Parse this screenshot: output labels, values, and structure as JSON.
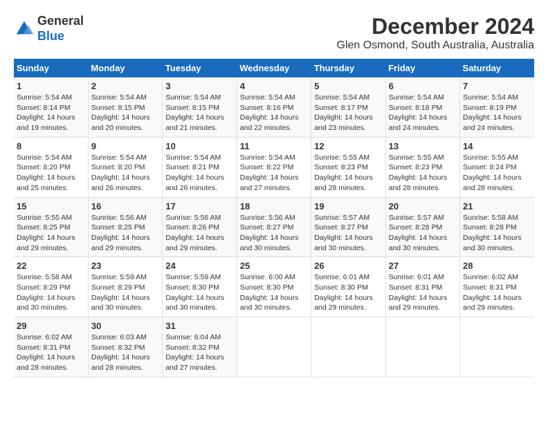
{
  "logo": {
    "line1": "General",
    "line2": "Blue"
  },
  "title": "December 2024",
  "subtitle": "Glen Osmond, South Australia, Australia",
  "days_of_week": [
    "Sunday",
    "Monday",
    "Tuesday",
    "Wednesday",
    "Thursday",
    "Friday",
    "Saturday"
  ],
  "weeks": [
    [
      {
        "day": "1",
        "sunrise": "5:54 AM",
        "sunset": "8:14 PM",
        "daylight": "14 hours and 19 minutes."
      },
      {
        "day": "2",
        "sunrise": "5:54 AM",
        "sunset": "8:15 PM",
        "daylight": "14 hours and 20 minutes."
      },
      {
        "day": "3",
        "sunrise": "5:54 AM",
        "sunset": "8:15 PM",
        "daylight": "14 hours and 21 minutes."
      },
      {
        "day": "4",
        "sunrise": "5:54 AM",
        "sunset": "8:16 PM",
        "daylight": "14 hours and 22 minutes."
      },
      {
        "day": "5",
        "sunrise": "5:54 AM",
        "sunset": "8:17 PM",
        "daylight": "14 hours and 23 minutes."
      },
      {
        "day": "6",
        "sunrise": "5:54 AM",
        "sunset": "8:18 PM",
        "daylight": "14 hours and 24 minutes."
      },
      {
        "day": "7",
        "sunrise": "5:54 AM",
        "sunset": "8:19 PM",
        "daylight": "14 hours and 24 minutes."
      }
    ],
    [
      {
        "day": "8",
        "sunrise": "5:54 AM",
        "sunset": "8:20 PM",
        "daylight": "14 hours and 25 minutes."
      },
      {
        "day": "9",
        "sunrise": "5:54 AM",
        "sunset": "8:20 PM",
        "daylight": "14 hours and 26 minutes."
      },
      {
        "day": "10",
        "sunrise": "5:54 AM",
        "sunset": "8:21 PM",
        "daylight": "14 hours and 26 minutes."
      },
      {
        "day": "11",
        "sunrise": "5:54 AM",
        "sunset": "8:22 PM",
        "daylight": "14 hours and 27 minutes."
      },
      {
        "day": "12",
        "sunrise": "5:55 AM",
        "sunset": "8:23 PM",
        "daylight": "14 hours and 28 minutes."
      },
      {
        "day": "13",
        "sunrise": "5:55 AM",
        "sunset": "8:23 PM",
        "daylight": "14 hours and 28 minutes."
      },
      {
        "day": "14",
        "sunrise": "5:55 AM",
        "sunset": "8:24 PM",
        "daylight": "14 hours and 28 minutes."
      }
    ],
    [
      {
        "day": "15",
        "sunrise": "5:55 AM",
        "sunset": "8:25 PM",
        "daylight": "14 hours and 29 minutes."
      },
      {
        "day": "16",
        "sunrise": "5:56 AM",
        "sunset": "8:25 PM",
        "daylight": "14 hours and 29 minutes."
      },
      {
        "day": "17",
        "sunrise": "5:56 AM",
        "sunset": "8:26 PM",
        "daylight": "14 hours and 29 minutes."
      },
      {
        "day": "18",
        "sunrise": "5:56 AM",
        "sunset": "8:27 PM",
        "daylight": "14 hours and 30 minutes."
      },
      {
        "day": "19",
        "sunrise": "5:57 AM",
        "sunset": "8:27 PM",
        "daylight": "14 hours and 30 minutes."
      },
      {
        "day": "20",
        "sunrise": "5:57 AM",
        "sunset": "8:28 PM",
        "daylight": "14 hours and 30 minutes."
      },
      {
        "day": "21",
        "sunrise": "5:58 AM",
        "sunset": "8:28 PM",
        "daylight": "14 hours and 30 minutes."
      }
    ],
    [
      {
        "day": "22",
        "sunrise": "5:58 AM",
        "sunset": "8:29 PM",
        "daylight": "14 hours and 30 minutes."
      },
      {
        "day": "23",
        "sunrise": "5:59 AM",
        "sunset": "8:29 PM",
        "daylight": "14 hours and 30 minutes."
      },
      {
        "day": "24",
        "sunrise": "5:59 AM",
        "sunset": "8:30 PM",
        "daylight": "14 hours and 30 minutes."
      },
      {
        "day": "25",
        "sunrise": "6:00 AM",
        "sunset": "8:30 PM",
        "daylight": "14 hours and 30 minutes."
      },
      {
        "day": "26",
        "sunrise": "6:01 AM",
        "sunset": "8:30 PM",
        "daylight": "14 hours and 29 minutes."
      },
      {
        "day": "27",
        "sunrise": "6:01 AM",
        "sunset": "8:31 PM",
        "daylight": "14 hours and 29 minutes."
      },
      {
        "day": "28",
        "sunrise": "6:02 AM",
        "sunset": "8:31 PM",
        "daylight": "14 hours and 29 minutes."
      }
    ],
    [
      {
        "day": "29",
        "sunrise": "6:02 AM",
        "sunset": "8:31 PM",
        "daylight": "14 hours and 28 minutes."
      },
      {
        "day": "30",
        "sunrise": "6:03 AM",
        "sunset": "8:32 PM",
        "daylight": "14 hours and 28 minutes."
      },
      {
        "day": "31",
        "sunrise": "6:04 AM",
        "sunset": "8:32 PM",
        "daylight": "14 hours and 27 minutes."
      },
      null,
      null,
      null,
      null
    ]
  ]
}
